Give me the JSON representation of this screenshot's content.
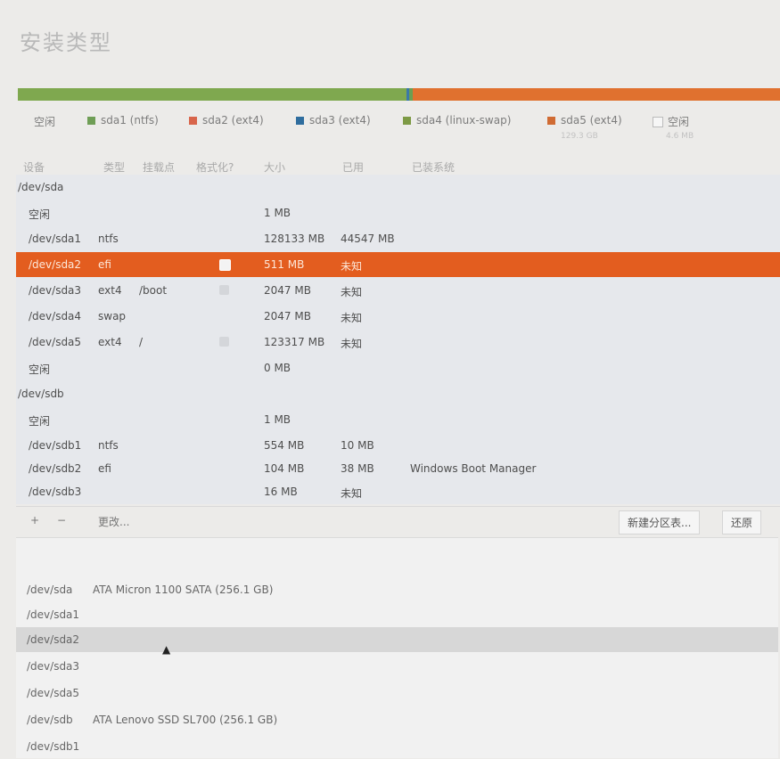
{
  "window": {
    "title": "安装类型"
  },
  "disk_bar": {
    "segments": [
      {
        "color": "#7fa84f",
        "share": 0.51
      },
      {
        "color": "#3b78a8",
        "share": 0.004
      },
      {
        "color": "#6a9f52",
        "share": 0.004
      },
      {
        "color": "#e0712f",
        "share": 0.482
      }
    ]
  },
  "legend": {
    "items": [
      {
        "label": "空闲",
        "color": ""
      },
      {
        "label": "sda1 (ntfs)",
        "color": "#6f9e56"
      },
      {
        "label": "sda2 (ext4)",
        "color": "#d8654b"
      },
      {
        "label": "sda3 (ext4)",
        "color": "#2f6d9e"
      },
      {
        "label": "sda4 (linux-swap)",
        "color": "#7d9a45"
      },
      {
        "label": "sda5 (ext4)",
        "color": "#d06b33",
        "sub": "129.3 GB"
      },
      {
        "label": "空闲",
        "color": "",
        "sub": "4.6 MB"
      }
    ]
  },
  "table": {
    "columns": [
      "设备",
      "类型",
      "挂载点",
      "格式化?",
      "大小",
      "已用",
      "已装系统"
    ],
    "rows": [
      {
        "device": "/dev/sda",
        "type": "",
        "mount": "",
        "size": "",
        "used": "",
        "system": "",
        "header": true
      },
      {
        "device": "空闲",
        "type": "",
        "mount": "",
        "size": "1 MB",
        "used": "",
        "system": ""
      },
      {
        "device": "/dev/sda1",
        "type": "ntfs",
        "mount": "",
        "size": "128133 MB",
        "used": "44547 MB",
        "system": ""
      },
      {
        "device": "/dev/sda2",
        "type": "efi",
        "mount": "",
        "size": "511 MB",
        "used": "未知",
        "system": "",
        "selected": true,
        "format": "on"
      },
      {
        "device": "/dev/sda3",
        "type": "ext4",
        "mount": "/boot",
        "size": "2047 MB",
        "used": "未知",
        "system": "",
        "format": "dim"
      },
      {
        "device": "/dev/sda4",
        "type": "swap",
        "mount": "",
        "size": "2047 MB",
        "used": "未知",
        "system": ""
      },
      {
        "device": "/dev/sda5",
        "type": "ext4",
        "mount": "/",
        "size": "123317 MB",
        "used": "未知",
        "system": "",
        "format": "dim"
      },
      {
        "device": "空闲",
        "type": "",
        "mount": "",
        "size": "0 MB",
        "used": "",
        "system": ""
      },
      {
        "device": "/dev/sdb",
        "type": "",
        "mount": "",
        "size": "",
        "used": "",
        "system": "",
        "header": true
      },
      {
        "device": "空闲",
        "type": "",
        "mount": "",
        "size": "1 MB",
        "used": "",
        "system": ""
      },
      {
        "device": "/dev/sdb1",
        "type": "ntfs",
        "mount": "",
        "size": "554 MB",
        "used": "10 MB",
        "system": ""
      },
      {
        "device": "/dev/sdb2",
        "type": "efi",
        "mount": "",
        "size": "104 MB",
        "used": "38 MB",
        "system": "Windows Boot Manager"
      },
      {
        "device": "/dev/sdb3",
        "type": "",
        "mount": "",
        "size": "16 MB",
        "used": "未知",
        "system": ""
      }
    ]
  },
  "toolbar": {
    "add": "+",
    "remove": "−",
    "change": "更改...",
    "new_table": "新建分区表...",
    "revert": "还原"
  },
  "boot_device": {
    "items": [
      {
        "device": "/dev/sda",
        "desc": "ATA Micron 1100 SATA (256.1 GB)"
      },
      {
        "device": "/dev/sda1",
        "desc": ""
      },
      {
        "device": "/dev/sda2",
        "desc": "",
        "highlighted": true
      },
      {
        "device": "/dev/sda3",
        "desc": ""
      },
      {
        "device": "/dev/sda5",
        "desc": ""
      },
      {
        "device": "/dev/sdb",
        "desc": "ATA Lenovo SSD SL700 (256.1 GB)"
      },
      {
        "device": "/dev/sdb1",
        "desc": ""
      }
    ]
  }
}
